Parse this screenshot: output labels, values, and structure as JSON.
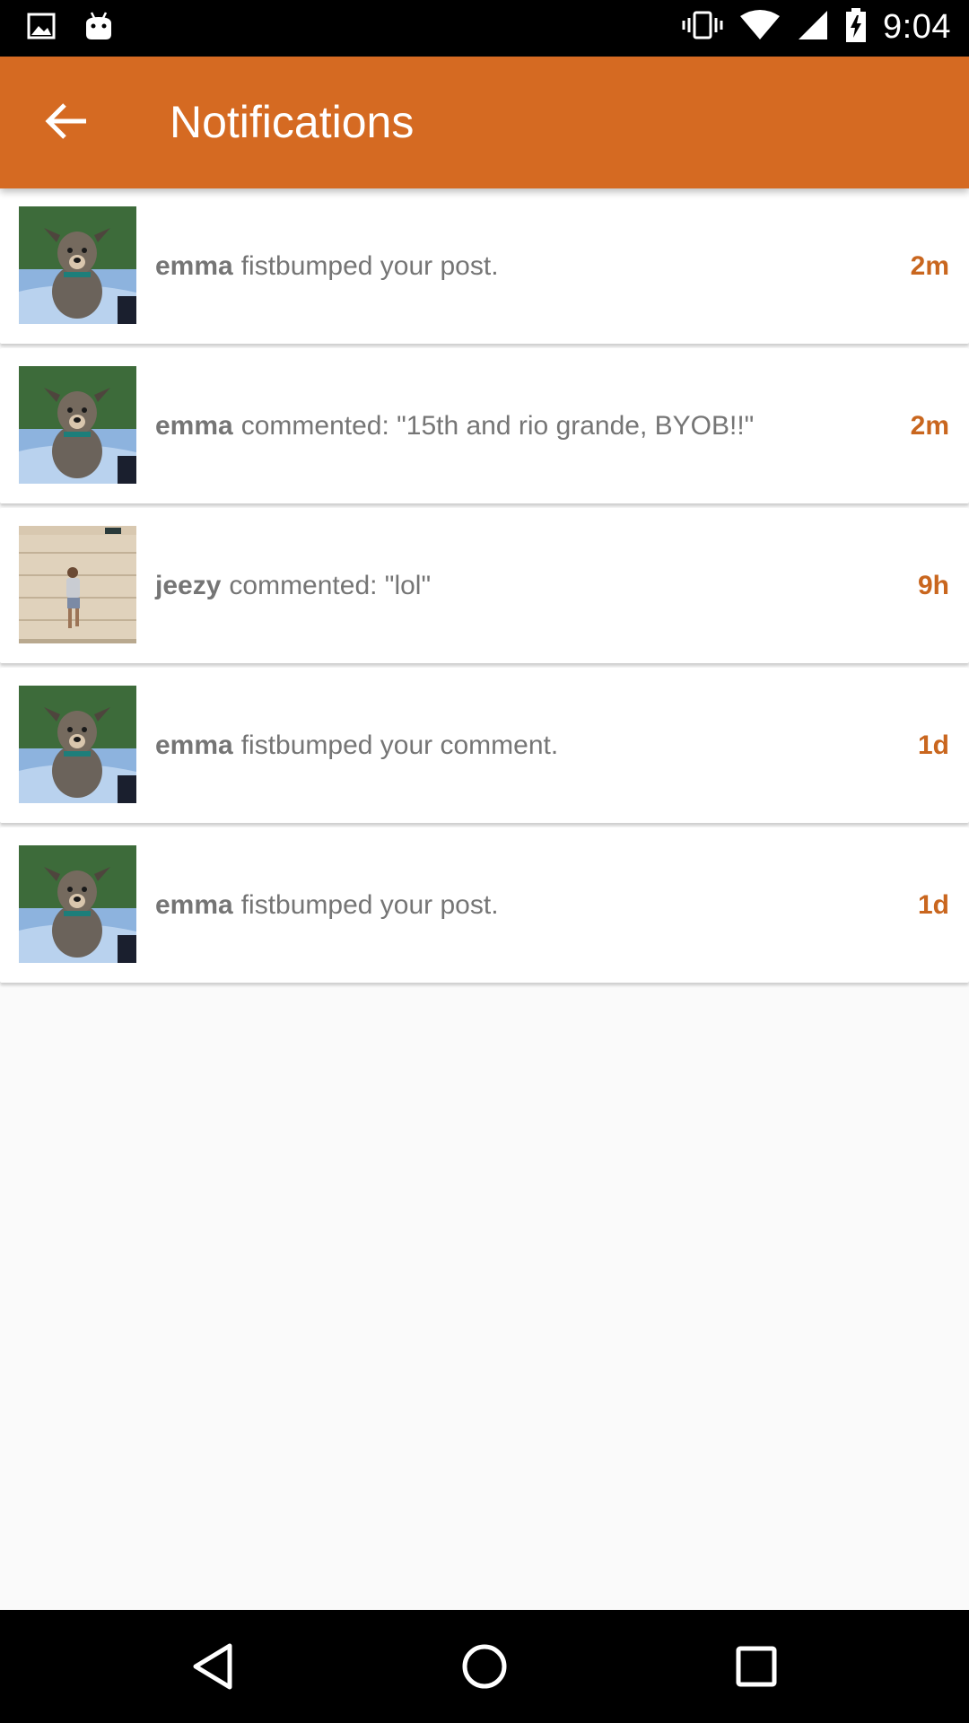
{
  "status_bar": {
    "time": "9:04",
    "icons": [
      "image-icon",
      "android-icon",
      "vibrate-icon",
      "wifi-icon",
      "signal-icon",
      "battery-charging-icon"
    ]
  },
  "app_bar": {
    "title": "Notifications",
    "back_icon": "arrow-back-icon",
    "color": "#d56a22"
  },
  "notifications": [
    {
      "user": "emma",
      "text": "fistbumped your post.",
      "time": "2m",
      "avatar": "dog-photo"
    },
    {
      "user": "emma",
      "text": "commented: \"15th and rio grande, BYOB!!\"",
      "time": "2m",
      "avatar": "dog-photo"
    },
    {
      "user": "jeezy",
      "text": "commented: \"lol\"",
      "time": "9h",
      "avatar": "man-by-garage-photo"
    },
    {
      "user": "emma",
      "text": "fistbumped your comment.",
      "time": "1d",
      "avatar": "dog-photo"
    },
    {
      "user": "emma",
      "text": "fistbumped your post.",
      "time": "1d",
      "avatar": "dog-photo"
    }
  ],
  "nav_bar": {
    "icons": [
      "back-triangle-icon",
      "home-circle-icon",
      "recents-square-icon"
    ]
  },
  "colors": {
    "accent": "#d56a22",
    "time_text": "#c9661e",
    "body_text": "#757575",
    "background": "#fafafa"
  }
}
